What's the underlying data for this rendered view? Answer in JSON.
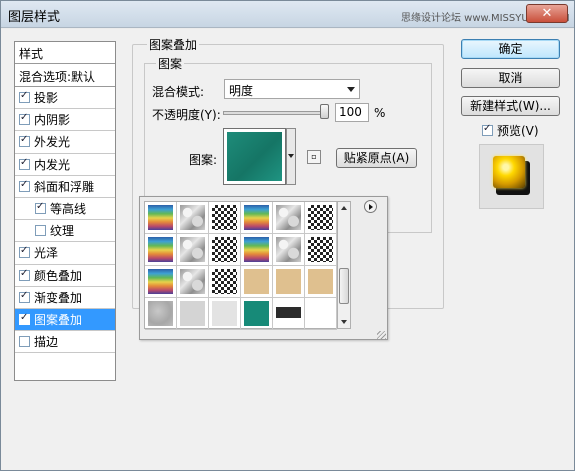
{
  "window": {
    "title": "图层样式",
    "watermark": "思缘设计论坛 www.MISSYUAN.COM",
    "close_glyph": "✕"
  },
  "style_list": {
    "header": "样式",
    "blend_options": "混合选项:默认",
    "items": [
      {
        "label": "投影",
        "checked": true,
        "sub": false,
        "selected": false
      },
      {
        "label": "内阴影",
        "checked": true,
        "sub": false,
        "selected": false
      },
      {
        "label": "外发光",
        "checked": true,
        "sub": false,
        "selected": false
      },
      {
        "label": "内发光",
        "checked": true,
        "sub": false,
        "selected": false
      },
      {
        "label": "斜面和浮雕",
        "checked": true,
        "sub": false,
        "selected": false
      },
      {
        "label": "等高线",
        "checked": true,
        "sub": true,
        "selected": false
      },
      {
        "label": "纹理",
        "checked": false,
        "sub": true,
        "selected": false
      },
      {
        "label": "光泽",
        "checked": true,
        "sub": false,
        "selected": false
      },
      {
        "label": "颜色叠加",
        "checked": true,
        "sub": false,
        "selected": false
      },
      {
        "label": "渐变叠加",
        "checked": true,
        "sub": false,
        "selected": false
      },
      {
        "label": "图案叠加",
        "checked": true,
        "sub": false,
        "selected": true
      },
      {
        "label": "描边",
        "checked": false,
        "sub": false,
        "selected": false
      }
    ]
  },
  "pattern_overlay": {
    "group_title": "图案叠加",
    "inner_title": "图案",
    "blend_mode_label": "混合模式:",
    "blend_mode_value": "明度",
    "opacity_label": "不透明度(Y):",
    "opacity_value": "100",
    "opacity_percent": 100,
    "opacity_unit": "%",
    "pattern_label": "图案:",
    "snap_button": "贴紧原点(A)",
    "new_preset_icon": "new-preset-icon"
  },
  "pattern_picker": {
    "tiles": [
      [
        "rainbow",
        "marble",
        "checker",
        "rainbow",
        "marble",
        "checker"
      ],
      [
        "rainbow",
        "marble",
        "checker",
        "rainbow",
        "marble",
        "checker"
      ],
      [
        "rainbow",
        "marble",
        "checker",
        "sand",
        "sand",
        "sand"
      ],
      [
        "gray1",
        "gray2",
        "gray3",
        "teal",
        "dark",
        "empty"
      ]
    ],
    "selected_tile": "teal"
  },
  "buttons": {
    "ok": "确定",
    "cancel": "取消",
    "new_style": "新建样式(W)..."
  },
  "preview": {
    "label": "预览(V)",
    "checked": true
  },
  "colors": {
    "selection": "#3399ff",
    "pattern_teal": "#178a78",
    "preview_gold": "#ffd800"
  }
}
